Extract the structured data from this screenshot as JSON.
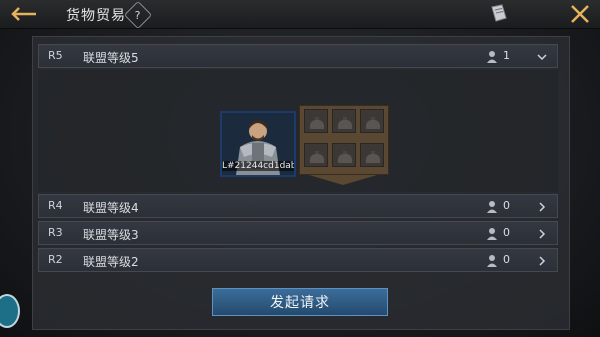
{
  "header": {
    "title": "货物贸易",
    "help_label": "?"
  },
  "ranks": [
    {
      "rank": "R5",
      "name": "联盟等级5",
      "count": "1",
      "expanded": true
    },
    {
      "rank": "R4",
      "name": "联盟等级4",
      "count": "0",
      "expanded": false
    },
    {
      "rank": "R3",
      "name": "联盟等级3",
      "count": "0",
      "expanded": false
    },
    {
      "rank": "R2",
      "name": "联盟等级2",
      "count": "0",
      "expanded": false
    }
  ],
  "member": {
    "name": "L#21244cd1dab"
  },
  "actions": {
    "request_label": "发起请求"
  },
  "colors": {
    "accent_blue": "#3b6d99",
    "cargo_brown": "#5b4832",
    "panel": "#2a2d31"
  },
  "icons": [
    "back-arrow-icon",
    "help-icon",
    "book-icon",
    "close-icon",
    "person-icon",
    "chevron-down-icon",
    "chevron-right-icon",
    "cargo-sack-icon"
  ]
}
